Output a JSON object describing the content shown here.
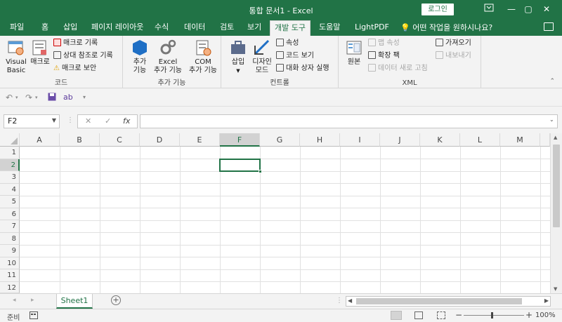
{
  "window": {
    "title": "통합 문서1  -  Excel",
    "login_label": "로그인",
    "minimize": "—",
    "restore": "▢",
    "close": "✕"
  },
  "tabs": [
    "파일",
    "홈",
    "삽입",
    "페이지 레이아웃",
    "수식",
    "데이터",
    "검토",
    "보기",
    "개발 도구",
    "도움말",
    "LightPDF"
  ],
  "active_tab": "개발 도구",
  "tell_me": "어떤 작업을 원하시나요?",
  "ribbon": {
    "code": {
      "label": "코드",
      "visual_basic": "Visual\nBasic",
      "macros": "매크로",
      "record_macro": "매크로 기록",
      "relative_refs": "상대 참조로 기록",
      "macro_security": "매크로 보안"
    },
    "addins": {
      "label": "추가 기능",
      "addins": "추가\n기능",
      "excel_addins": "Excel\n추가 기능",
      "com_addins": "COM\n추가 기능"
    },
    "controls": {
      "label": "컨트롤",
      "insert": "삽입",
      "design_mode": "디자인\n모드",
      "properties": "속성",
      "view_code": "코드 보기",
      "run_dialog": "대화 상자 실행"
    },
    "xml": {
      "label": "XML",
      "source": "원본",
      "map_properties": "맵 속성",
      "expansion_packs": "확장 팩",
      "refresh_data": "데이터 새로 고침",
      "import": "가져오기",
      "export": "내보내기"
    }
  },
  "formula_bar": {
    "name_box": "F2",
    "cancel": "✕",
    "enter": "✓",
    "fx": "fx",
    "formula": ""
  },
  "grid": {
    "columns": [
      "A",
      "B",
      "C",
      "D",
      "E",
      "F",
      "G",
      "H",
      "I",
      "J",
      "K",
      "L",
      "M"
    ],
    "rows": [
      "1",
      "2",
      "3",
      "4",
      "5",
      "6",
      "7",
      "8",
      "9",
      "10",
      "11",
      "12"
    ],
    "selected_cell": "F2"
  },
  "sheets": [
    "Sheet1"
  ],
  "active_sheet": "Sheet1",
  "status": {
    "ready": "준비",
    "zoom": "100%",
    "zoom_minus": "−",
    "zoom_plus": "+"
  },
  "colors": {
    "accent": "#217346"
  }
}
